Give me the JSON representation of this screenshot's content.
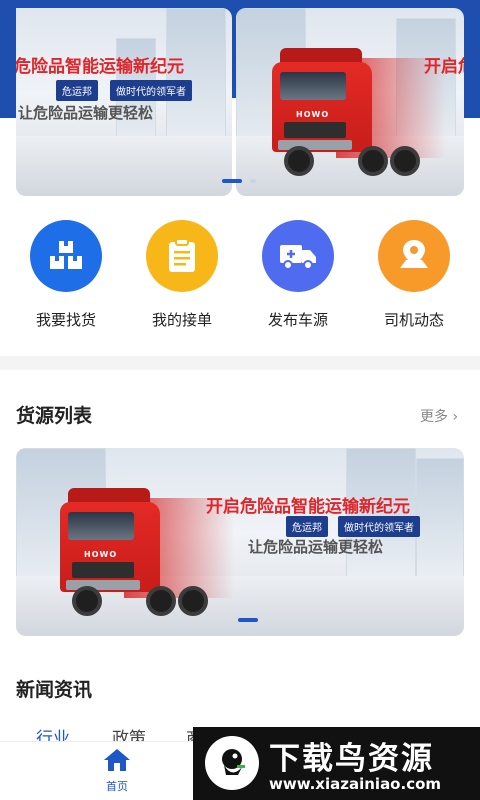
{
  "banner": {
    "slogan_main": "危险品智能运输新纪元",
    "slogan_partial": "开启危",
    "tag_hazard": "危运邦",
    "tag_leader": "做时代的领军者",
    "slogan_sub": "让危险品运输更轻松",
    "truck_logo": "HOWO"
  },
  "actions": [
    {
      "label": "我要找货",
      "icon": "boxes-icon",
      "color": "#1e6ee8"
    },
    {
      "label": "我的接单",
      "icon": "clipboard-icon",
      "color": "#f7b718"
    },
    {
      "label": "发布车源",
      "icon": "truck-icon",
      "color": "#4f6cf0"
    },
    {
      "label": "司机动态",
      "icon": "map-pin-icon",
      "color": "#f79a2a"
    }
  ],
  "goods_section": {
    "title": "货源列表",
    "more": "更多",
    "banner": {
      "slogan_main": "开启危险品智能运输新纪元",
      "tag_hazard": "危运邦",
      "tag_leader": "做时代的领军者",
      "slogan_sub": "让危险品运输更轻松"
    }
  },
  "news_section": {
    "title": "新闻资讯",
    "tabs": [
      "行业",
      "政策",
      "商"
    ]
  },
  "bottom_nav": {
    "home_label": "首页"
  },
  "watermark": {
    "title": "下载鸟资源",
    "url": "www.xiazainiao.com"
  },
  "colors": {
    "brand_blue": "#1f56c8",
    "banner_band": "#1f4fae",
    "slogan_red": "#e0262a"
  }
}
